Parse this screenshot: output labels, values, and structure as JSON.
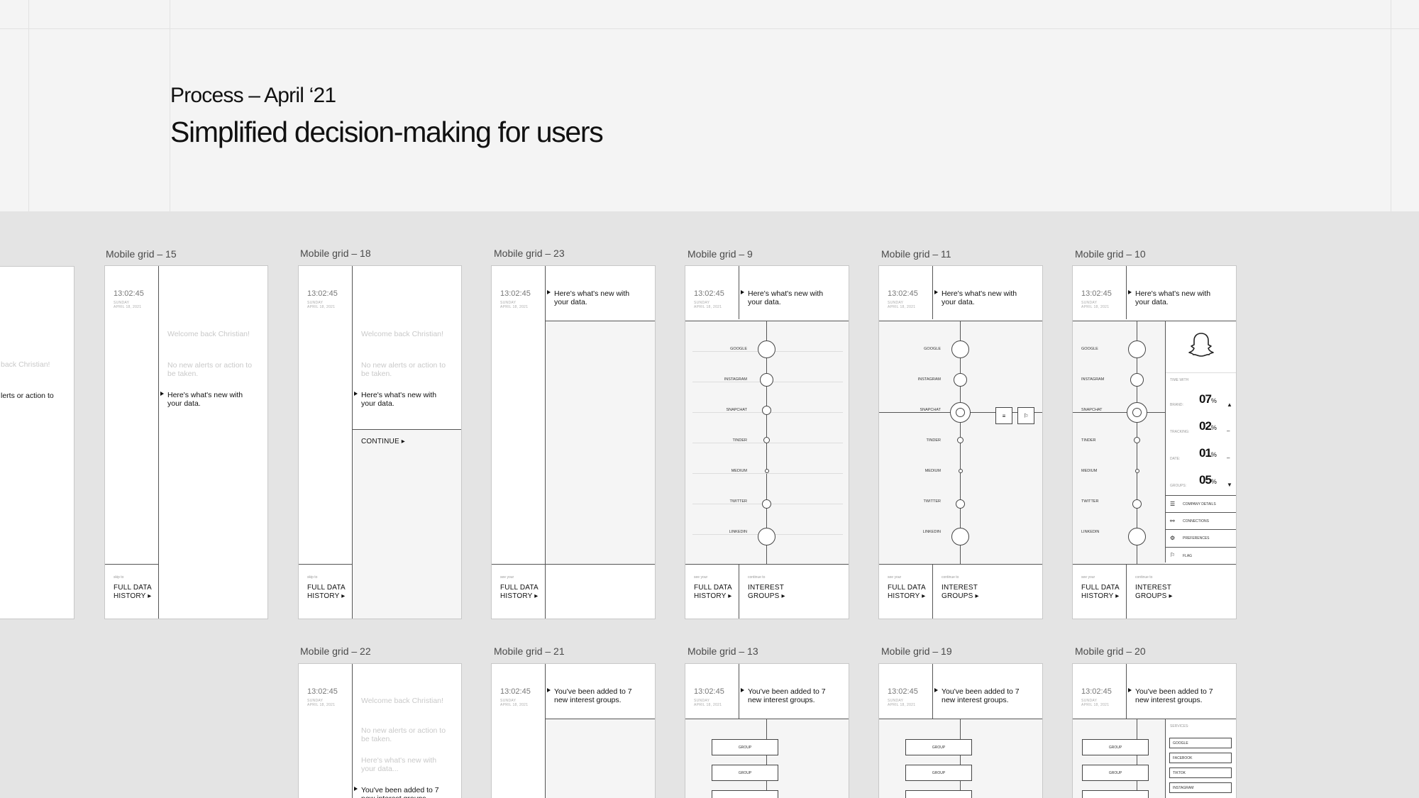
{
  "header": {
    "kicker": "Process – April ‘21",
    "title": "Simplified decision-making for users"
  },
  "frames": {
    "f15": "Mobile grid – 15",
    "f18": "Mobile grid – 18",
    "f23": "Mobile grid – 23",
    "f9": "Mobile grid – 9",
    "f11": "Mobile grid – 11",
    "f10": "Mobile grid – 10",
    "f22": "Mobile grid – 22",
    "f21": "Mobile grid – 21",
    "f13": "Mobile grid – 13",
    "f19": "Mobile grid – 19",
    "f20": "Mobile grid – 20"
  },
  "screen": {
    "time": "13:02:45",
    "day": "SUNDAY",
    "date": "APRIL 18, 2021",
    "welcome": "Welcome back Christian!",
    "no_alerts": "No new alerts or action to be taken.",
    "whats_new": "Here's what's new with your data.",
    "whats_new_faint": "Here's what's new with your data...",
    "added_groups": "You've been added to 7 new interest groups.",
    "continue": "CONTINUE ▸",
    "partial_welcome": "back Christian!",
    "partial_alerts": "lerts or action to",
    "skip_to": "skip to",
    "see_your": "see your",
    "continue_to": "continue to",
    "full_data": "FULL DATA",
    "history": "HISTORY ▸",
    "interest": "INTEREST",
    "groups": "GROUPS ▸",
    "group": "GROUP"
  },
  "services": [
    "GOOGLE",
    "INSTAGRAM",
    "SNAPCHAT",
    "TINDER",
    "MEDIUM",
    "TWITTER",
    "LINKEDIN"
  ],
  "detail": {
    "time_with": "TIME WITH",
    "rows": [
      {
        "label": "BRAND:",
        "value": "07",
        "unit": "%",
        "trend": "▲"
      },
      {
        "label": "TRACKING:",
        "value": "02",
        "unit": "%",
        "trend": "–"
      },
      {
        "label": "DATE:",
        "value": "01",
        "unit": "%",
        "trend": "–"
      },
      {
        "label": "GROUPS:",
        "value": "05",
        "unit": "%",
        "trend": "▼"
      }
    ],
    "menu": [
      "COMPANY DETAILS",
      "CONNECTIONS",
      "PREFERENCES",
      "FLAG"
    ]
  },
  "groups_panel": {
    "services_label": "SERVICES:",
    "options": [
      "GOOGLE",
      "FACEBOOK",
      "TIKTOK",
      "INSTAGRAM"
    ]
  }
}
